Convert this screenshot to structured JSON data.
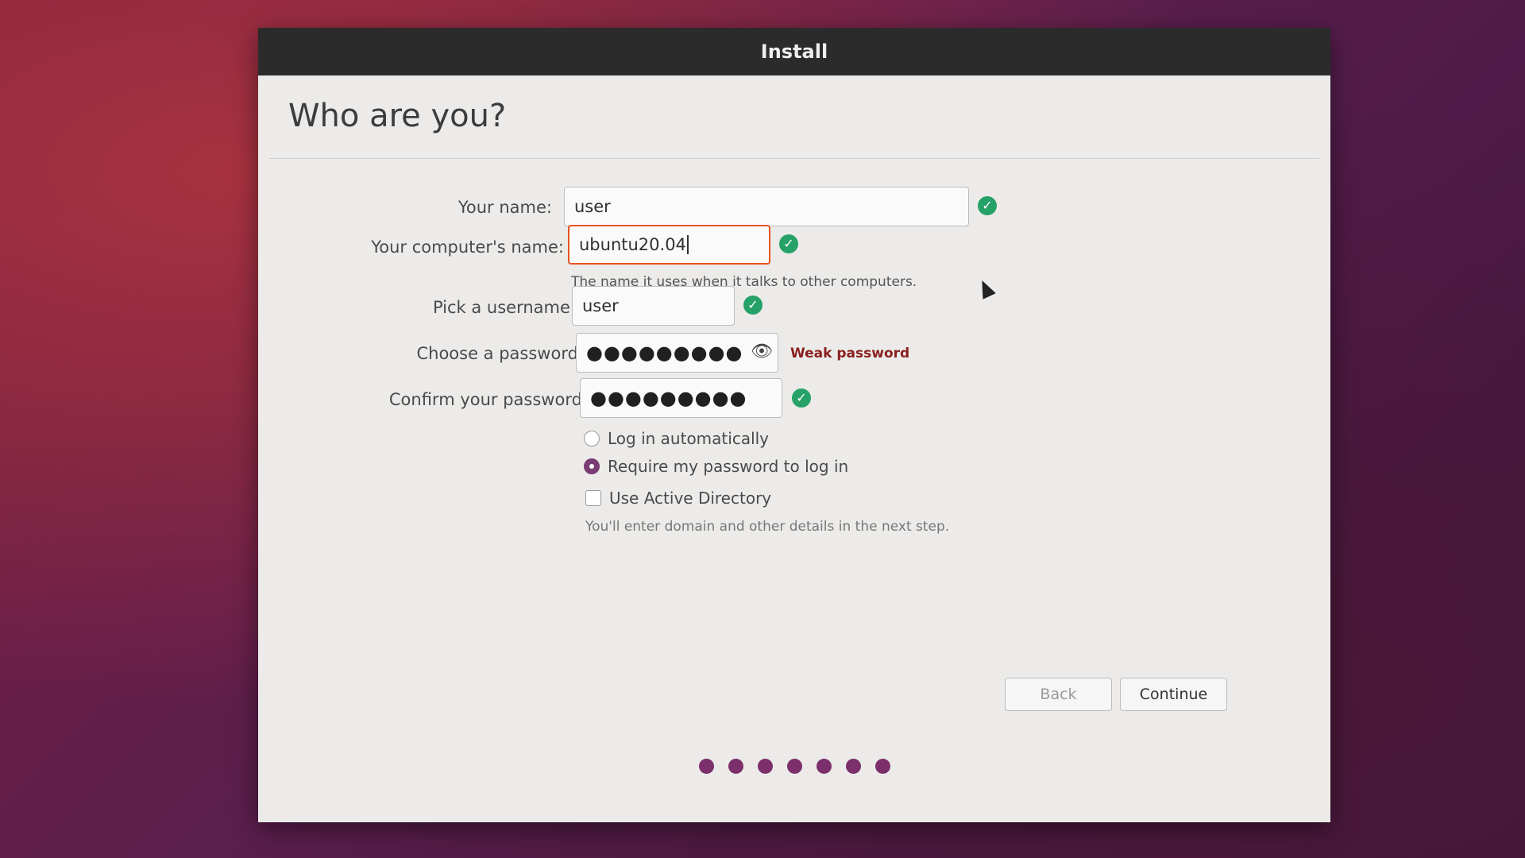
{
  "window": {
    "title": "Install"
  },
  "page": {
    "heading": "Who are you?"
  },
  "form": {
    "name_label": "Your name:",
    "name_value": "user",
    "computer_label": "Your computer's name:",
    "computer_value": "ubuntu20.04",
    "computer_hint": "The name it uses when it talks to other computers.",
    "username_label": "Pick a username:",
    "username_value": "user",
    "password_label": "Choose a password:",
    "password_mask": "●●●●●●●●●",
    "password_strength": "Weak password",
    "confirm_label": "Confirm your password:",
    "confirm_mask": "●●●●●●●●●"
  },
  "login_options": {
    "auto_login": "Log in automatically",
    "require_password": "Require my password to log in",
    "selected": "require_password"
  },
  "active_directory": {
    "label": "Use Active Directory",
    "hint": "You'll enter domain and other details in the next step.",
    "checked": false
  },
  "buttons": {
    "back": "Back",
    "continue": "Continue"
  },
  "progress": {
    "steps": 7
  },
  "colors": {
    "accent": "#e95420",
    "valid": "#26a269",
    "progress": "#7b2f6b",
    "weak": "#8a1f1f"
  },
  "icons": {
    "valid": "check-circle-icon",
    "reveal": "eye-icon"
  }
}
